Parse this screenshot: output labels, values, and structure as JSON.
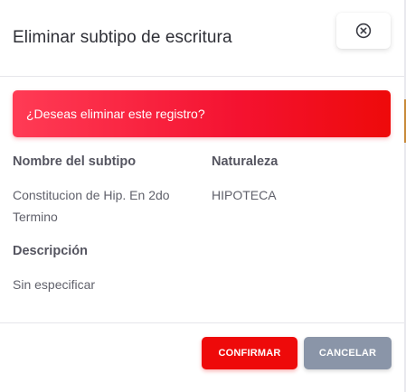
{
  "modal": {
    "title": "Eliminar subtipo de escritura",
    "close_icon": "close-circle-x-icon"
  },
  "alert": {
    "message": "¿Deseas eliminar este registro?",
    "color": "#f41230"
  },
  "fields": {
    "subtype_name": {
      "label": "Nombre del subtipo",
      "value_line1": "Constitucion de Hip. En 2do",
      "value_line2": "Termino"
    },
    "nature": {
      "label": "Naturaleza",
      "value": "HIPOTECA"
    },
    "description": {
      "label": "Descripción",
      "value": "Sin especificar"
    }
  },
  "footer": {
    "confirm_label": "CONFIRMAR",
    "cancel_label": "CANCELAR"
  },
  "colors": {
    "confirm": "#ee0a0a",
    "cancel": "#8a95a8",
    "title_text": "#2e2f36"
  }
}
